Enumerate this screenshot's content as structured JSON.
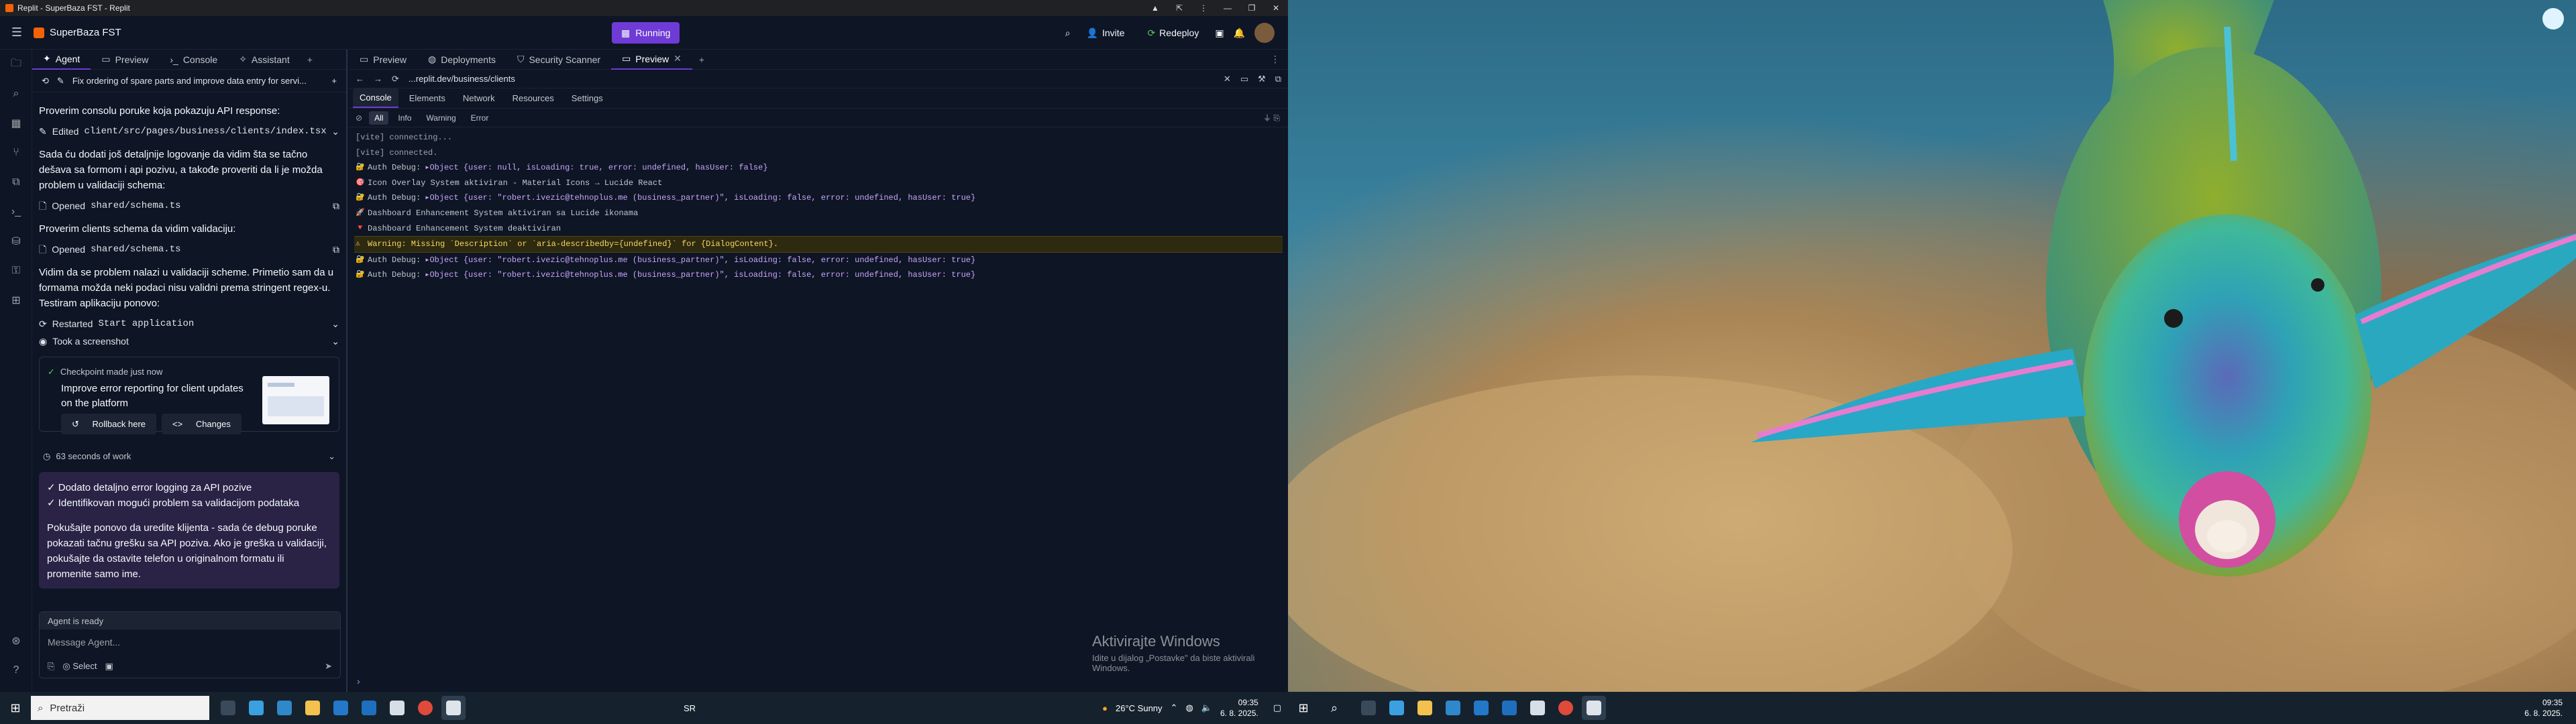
{
  "window": {
    "title": "Replit - SuperBaza FST - Replit",
    "controls": [
      "▲",
      "⇱",
      "⋮",
      "—",
      "❐",
      "✕"
    ]
  },
  "appbar": {
    "project_name": "SuperBaza FST",
    "run_label": "Running",
    "invite_label": "Invite",
    "redeploy_label": "Redeploy"
  },
  "left_tabs": [
    {
      "label": "Agent",
      "icon": "agent-icon"
    },
    {
      "label": "Preview",
      "icon": "preview-icon"
    },
    {
      "label": "Console",
      "icon": "console-icon"
    },
    {
      "label": "Assistant",
      "icon": "assistant-icon"
    }
  ],
  "right_tabs": [
    {
      "label": "Preview",
      "icon": "preview-icon"
    },
    {
      "label": "Deployments",
      "icon": "deployments-icon"
    },
    {
      "label": "Security Scanner",
      "icon": "shield-icon"
    },
    {
      "label": "Preview",
      "icon": "preview-icon"
    }
  ],
  "agent": {
    "thread_title": "Fix ordering of spare parts and improve data entry for servi...",
    "msg1": "Proverim consolu poruke koja pokazuju API response:",
    "act1_prefix": "Edited",
    "act1_file": "client/src/pages/business/clients/index.tsx",
    "msg2": "Sada ću dodati još detaljnije logovanje da vidim šta se tačno dešava sa formom i api pozivu, a takođe proveriti da li je možda problem u validaciji schema:",
    "act2_prefix": "Opened",
    "act2_file": "shared/schema.ts",
    "msg3": "Proverim clients schema da vidim validaciju:",
    "act3_prefix": "Opened",
    "act3_file": "shared/schema.ts",
    "msg4": "Vidim da se problem nalazi u validaciji scheme. Primetio sam da u formama možda neki podaci nisu validni prema stringent regex-u. Testiram aplikaciju ponovo:",
    "act4_prefix": "Restarted",
    "act4_target": "Start application",
    "act5": "Took a screenshot",
    "checkpoint_head": "Checkpoint made just now",
    "checkpoint_title": "Improve error reporting for client updates on the platform",
    "rollback_label": "Rollback here",
    "changes_label": "Changes",
    "work_time": "63 seconds of work",
    "summary_items": [
      "✓ Dodato detaljno error logging za API pozive",
      "✓ Identifikovan mogući problem sa validacijom podataka"
    ],
    "summary_para": "Pokušajte ponovo da uredite klijenta - sada će debug poruke pokazati tačnu grešku sa API poziva. Ako je greška u validaciji, pokušajte da ostavite telefon u originalnom formatu ili promenite samo ime.",
    "status": "Agent is ready",
    "placeholder": "Message Agent...",
    "select_label": "Select"
  },
  "preview": {
    "url": "...replit.dev/business/clients"
  },
  "devtools": {
    "tabs": [
      "Console",
      "Elements",
      "Network",
      "Resources",
      "Settings"
    ],
    "filters": [
      "All",
      "Info",
      "Warning",
      "Error"
    ]
  },
  "console_lines": {
    "l1": "[vite] connecting...",
    "l2": "[vite] connected.",
    "l3_label": "Auth Debug:",
    "l3_obj": "▸Object {user: null, isLoading: true, error: undefined, hasUser: false}",
    "l4": "Icon Overlay System aktiviran - Material Icons → Lucide React",
    "l5_label": "Auth Debug:",
    "l5_obj": "▸Object {user: \"robert.ivezic@tehnoplus.me (business_partner)\", isLoading: false, error: undefined, hasUser: true}",
    "l6": "Dashboard Enhancement System aktiviran sa Lucide ikonama",
    "l7": "Dashboard Enhancement System deaktiviran",
    "l8": "Warning: Missing `Description` or `aria-describedby={undefined}` for {DialogContent}.",
    "l9_label": "Auth Debug:",
    "l9_obj": "▸Object {user: \"robert.ivezic@tehnoplus.me (business_partner)\", isLoading: false, error: undefined, hasUser: true}",
    "l10_label": "Auth Debug:",
    "l10_obj": "▸Object {user: \"robert.ivezic@tehnoplus.me (business_partner)\", isLoading: false, error: undefined, hasUser: true}"
  },
  "watermark": {
    "line1": "Aktivirajte Windows",
    "line2": "Idite u dijalog „Postavke\" da biste aktivirali Windows."
  },
  "taskbar_left": {
    "search_placeholder": "Pretraži",
    "lang": "SR",
    "weather": "26°C  Sunny",
    "time": "09:35",
    "date": "6. 8. 2025."
  },
  "taskbar_right": {
    "time": "09:35",
    "date": "6. 8. 2025."
  },
  "colors": {
    "accent": "#6e3bd6",
    "bg": "#0e1525",
    "warn_bg": "#2e2a10",
    "summary_bg": "#2a2346"
  }
}
